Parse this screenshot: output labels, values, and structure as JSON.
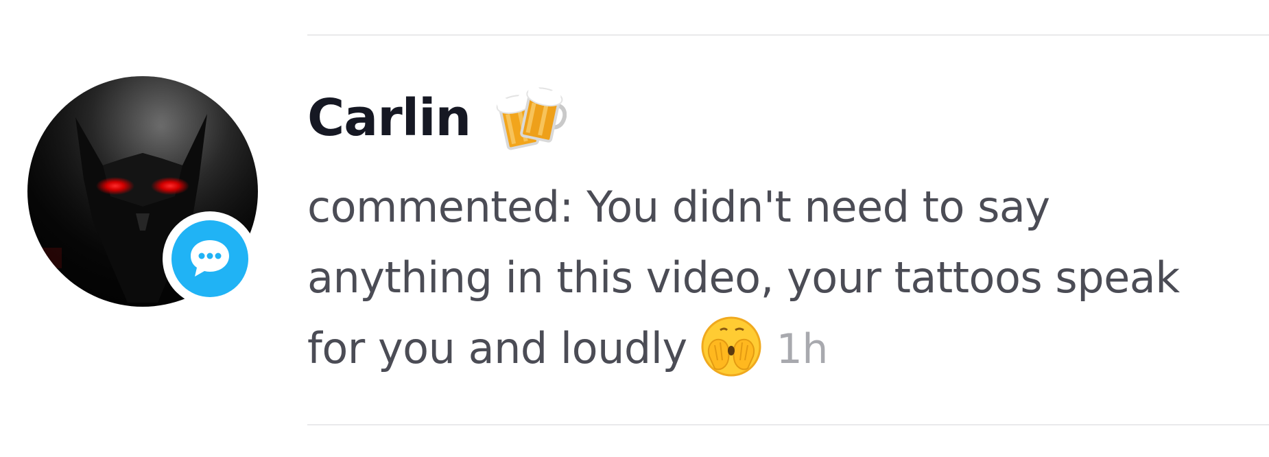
{
  "notification": {
    "username": "Carlin",
    "username_emoji": "beers-emoji",
    "comment_text": "commented: You didn't need to say anything in this video, your tattoos speak for you and loudly",
    "comment_emoji": "see-no-evil-face-emoji",
    "timestamp": "1h",
    "type_badge_icon": "chat-bubble-icon"
  },
  "colors": {
    "badge": "#20b3f5",
    "username": "#161823",
    "comment": "#4b4c55",
    "timestamp": "#a8a9ae",
    "divider": "#e9e9eb"
  }
}
